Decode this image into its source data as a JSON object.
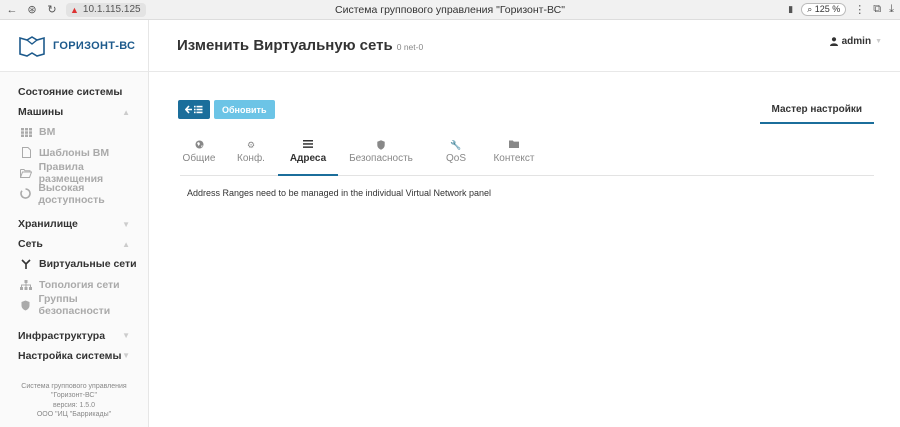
{
  "browser": {
    "url": "10.1.115.125",
    "title": "Система группового управления \"Горизонт-ВС\"",
    "zoom": "125 %"
  },
  "sidebar": {
    "logo_text": "ГОРИЗОНТ-ВС",
    "system_status": "Состояние системы",
    "machines": "Машины",
    "vm": "ВМ",
    "vm_templates": "Шаблоны ВМ",
    "placement_rules": "Правила размещения",
    "high_availability": "Высокая доступность",
    "storage": "Хранилище",
    "network": "Сеть",
    "virtual_networks": "Виртуальные сети",
    "network_topology": "Топология сети",
    "security_groups": "Группы безопасности",
    "infrastructure": "Инфраструктура",
    "system_settings": "Настройка системы",
    "footer": {
      "line1": "Система группового управления",
      "line2": "\"Горизонт-ВС\"",
      "line3": "версия: 1.5.0",
      "line4": "ООО \"ИЦ \"Баррикады\""
    }
  },
  "header": {
    "title": "Изменить Виртуальную сеть",
    "subtitle": "0 net-0",
    "user": "admin"
  },
  "toolbar": {
    "refresh_label": "Обновить",
    "wizard_label": "Мастер настройки"
  },
  "tabs": {
    "general": "Общие",
    "conf": "Конф.",
    "addresses": "Адреса",
    "security": "Безопасность",
    "qos": "QoS",
    "context": "Контекст"
  },
  "content": {
    "notice": "Address Ranges need to be managed in the individual Virtual Network panel"
  },
  "colors": {
    "primary": "#1b6e9b",
    "refresh": "#6cc4e6",
    "logo": "#1d5a8c"
  }
}
